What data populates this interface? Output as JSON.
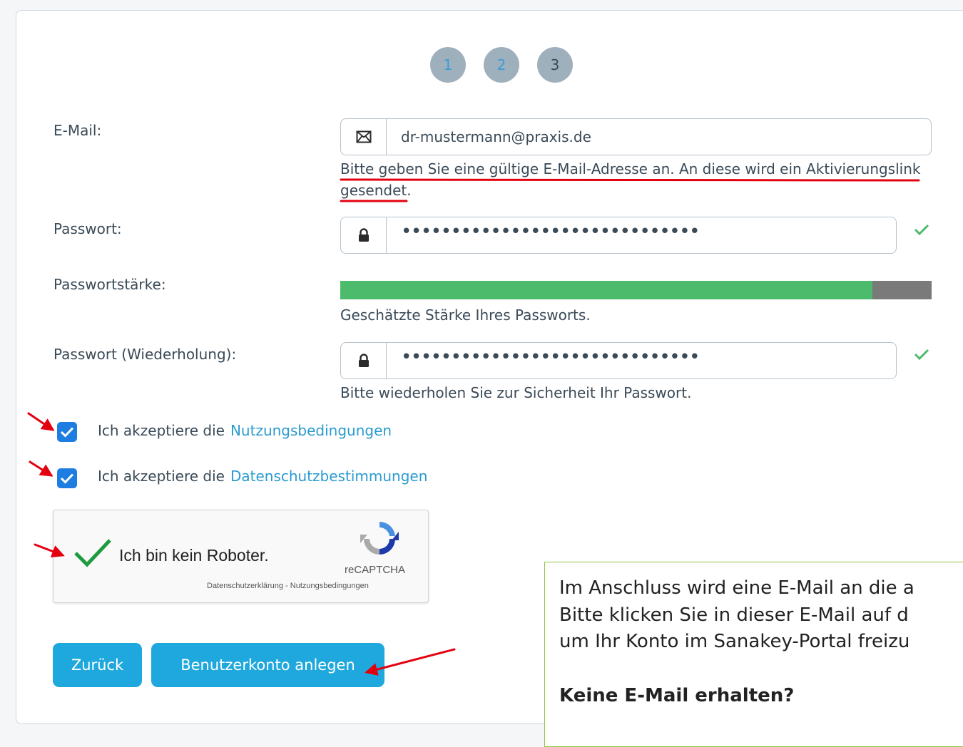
{
  "steps": [
    "1",
    "2",
    "3"
  ],
  "email": {
    "label": "E-Mail:",
    "value": "dr-mustermann@praxis.de",
    "help_line1": "Bitte geben Sie eine gültige E-Mail-Adresse an. An diese wird ein Aktivierungslink",
    "help_line2": "gesendet."
  },
  "password": {
    "label": "Passwort:",
    "value": "••••••••••••••••••••••••••••••"
  },
  "strength": {
    "label": "Passwortstärke:",
    "level_percent": 90,
    "help": "Geschätzte Stärke Ihres Passworts."
  },
  "password_repeat": {
    "label": "Passwort (Wiederholung):",
    "value": "••••••••••••••••••••••••••••••",
    "help": "Bitte wiederholen Sie zur Sicherheit Ihr Passwort."
  },
  "terms": {
    "prefix": "Ich akzeptiere die",
    "link": "Nutzungsbedingungen"
  },
  "privacy": {
    "prefix": "Ich akzeptiere die",
    "link": "Datenschutzbestimmungen"
  },
  "recaptcha": {
    "label": "Ich bin kein Roboter.",
    "brand": "reCAPTCHA",
    "footer": "Datenschutzerklärung - Nutzungsbedingungen"
  },
  "buttons": {
    "back": "Zurück",
    "create": "Benutzerkonto anlegen"
  },
  "note": {
    "line1": "Im Anschluss wird eine E-Mail an die a",
    "line2": "Bitte klicken Sie in dieser E-Mail auf d",
    "line3": "um Ihr Konto im Sanakey-Portal freizu",
    "heading": "Keine E-Mail erhalten?"
  },
  "colors": {
    "accent": "#1ea8dd",
    "link": "#2a9bd0",
    "strength": "#4cbb6c",
    "annotation": "#e3000f",
    "note_border": "#8cc63f"
  }
}
